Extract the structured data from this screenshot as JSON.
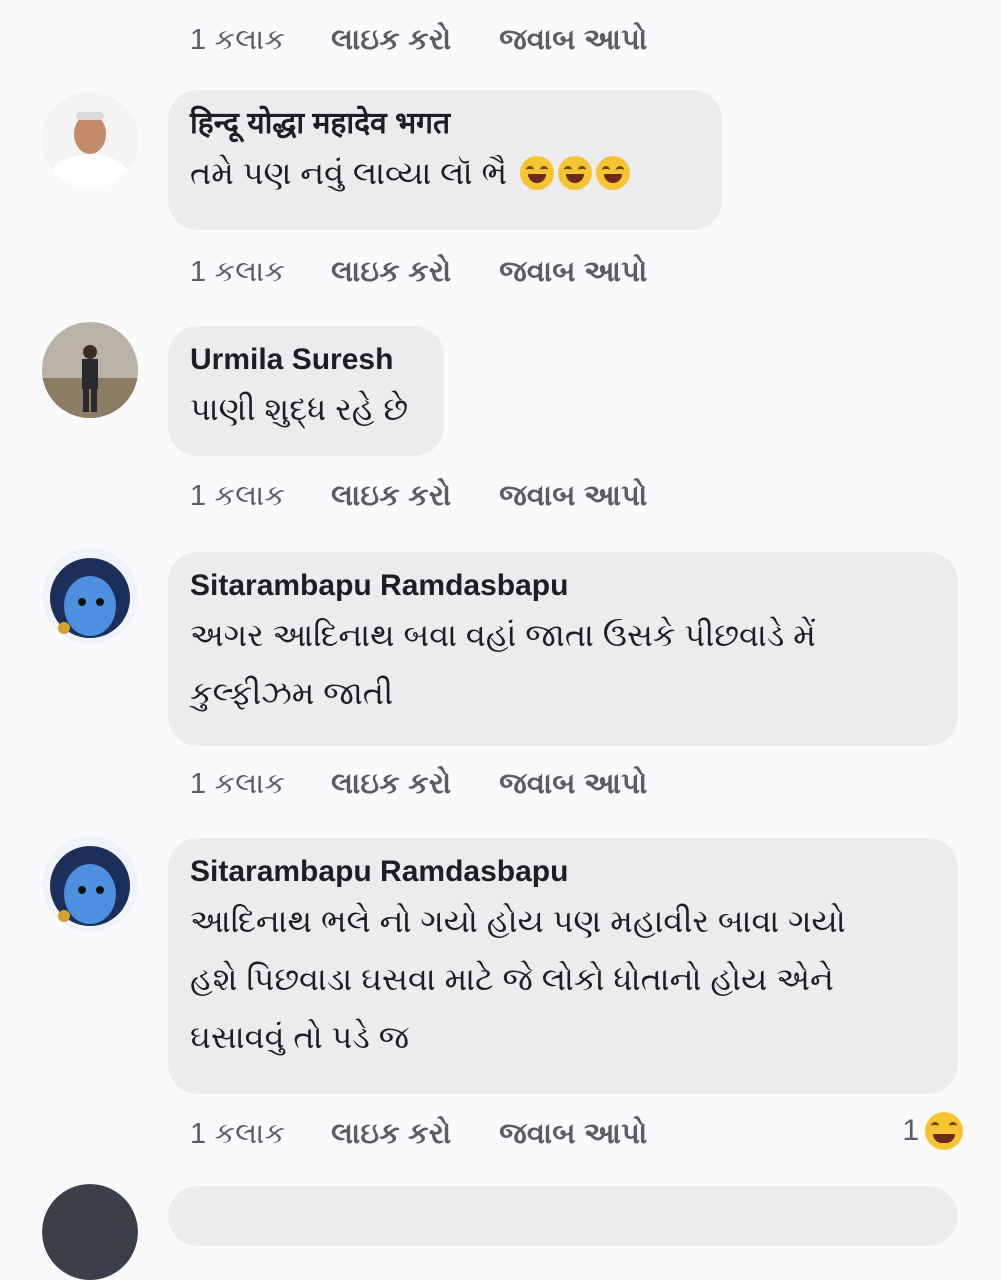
{
  "actions": {
    "time": "1 કલાક",
    "like": "લાઇક કરો",
    "reply": "જવાબ આપો"
  },
  "comments": [
    {
      "name": "हिन्दू योद्धा महादेव भगत",
      "text": "તમે પણ નવું લાવ્યા લૉ ભૈ",
      "emojis": [
        "rolling-on-floor-laughing",
        "tears-of-joy",
        "grinning-squinting"
      ]
    },
    {
      "name": "Urmila Suresh",
      "text": "પાણી શુદ્ધ રહે છે"
    },
    {
      "name": "Sitarambapu Ramdasbapu",
      "text_lines": [
        "અગર આદિનાથ બવા વહાં જાતા ઉસકે પીછવાડે મેં",
        "કુલ્ફીઝમ જાતી"
      ]
    },
    {
      "name": "Sitarambapu Ramdasbapu",
      "text_lines": [
        "આદિનાથ ભલે નો ગયો હોય પણ મહાવીર બાવા ગયો",
        "હશે પિછવાડા ઘસવા માટે જે લોકો ધોતાનો હોય એને",
        "ઘસાવવું તો પડે જ"
      ],
      "reaction": {
        "count": "1",
        "emoji": "laughing"
      }
    }
  ],
  "colors": {
    "background": "#fafafc",
    "bubble": "#ececef",
    "meta_text": "#5a5d63"
  }
}
